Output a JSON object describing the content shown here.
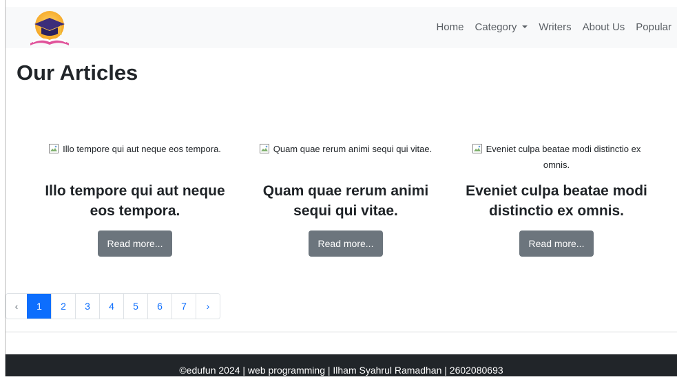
{
  "nav": {
    "logo_icon": "graduation-cap-book-logo",
    "links": [
      "Home",
      "Category",
      "Writers",
      "About Us",
      "Popular"
    ]
  },
  "main": {
    "title": "Our Articles",
    "articles": [
      {
        "image_alt": "Illo tempore qui aut neque eos tempora.",
        "title": "Illo tempore qui aut neque eos tempora.",
        "button": "Read more..."
      },
      {
        "image_alt": "Quam quae rerum animi sequi qui vitae.",
        "title": "Quam quae rerum animi sequi qui vitae.",
        "button": "Read more..."
      },
      {
        "image_alt": "Eveniet culpa beatae modi distinctio ex omnis.",
        "title": "Eveniet culpa beatae modi distinctio ex omnis.",
        "button": "Read more..."
      }
    ]
  },
  "pagination": {
    "prev": "‹",
    "pages": [
      "1",
      "2",
      "3",
      "4",
      "5",
      "6",
      "7"
    ],
    "next": "›",
    "active": "1"
  },
  "footer": {
    "text": "©edufun 2024 | web programming | Ilham Syahrul Ramadhan | 2602080693"
  },
  "colors": {
    "navbar_bg": "#f8f9fa",
    "button_secondary": "#6c757d",
    "primary": "#0d6efd",
    "footer_bg": "#212529"
  }
}
